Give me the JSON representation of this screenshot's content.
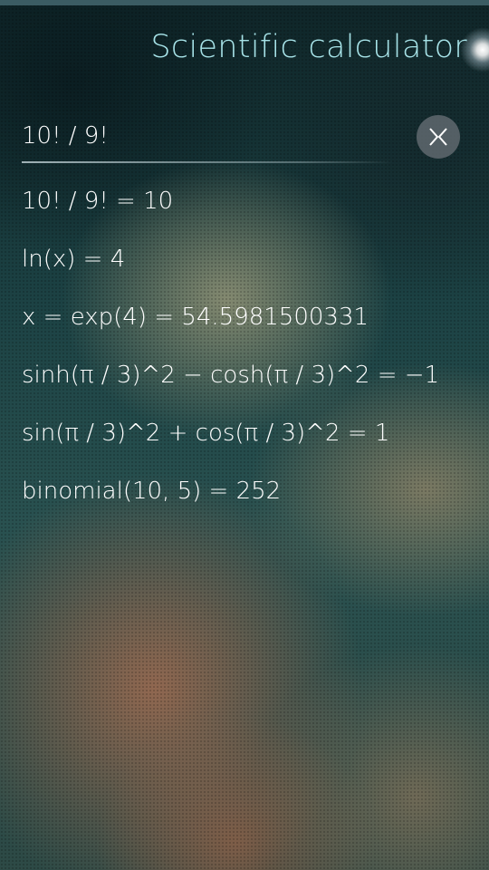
{
  "colors": {
    "title": "#a7e3e8",
    "text": "#ffffff",
    "clear_button_bg": "#5f696e"
  },
  "header": {
    "title": "Scientific calculator"
  },
  "input": {
    "value": "10! / 9!",
    "clear_icon": "close-icon"
  },
  "history": [
    {
      "text": "10! / 9! = 10"
    },
    {
      "text": "ln(x) = 4"
    },
    {
      "text": "x = exp(4) = 54.5981500331"
    },
    {
      "text": "sinh(π / 3)^2 − cosh(π / 3)^2 = −1"
    },
    {
      "text": "sin(π / 3)^2 + cos(π / 3)^2 = 1"
    },
    {
      "text": "binomial(10, 5) = 252"
    }
  ]
}
